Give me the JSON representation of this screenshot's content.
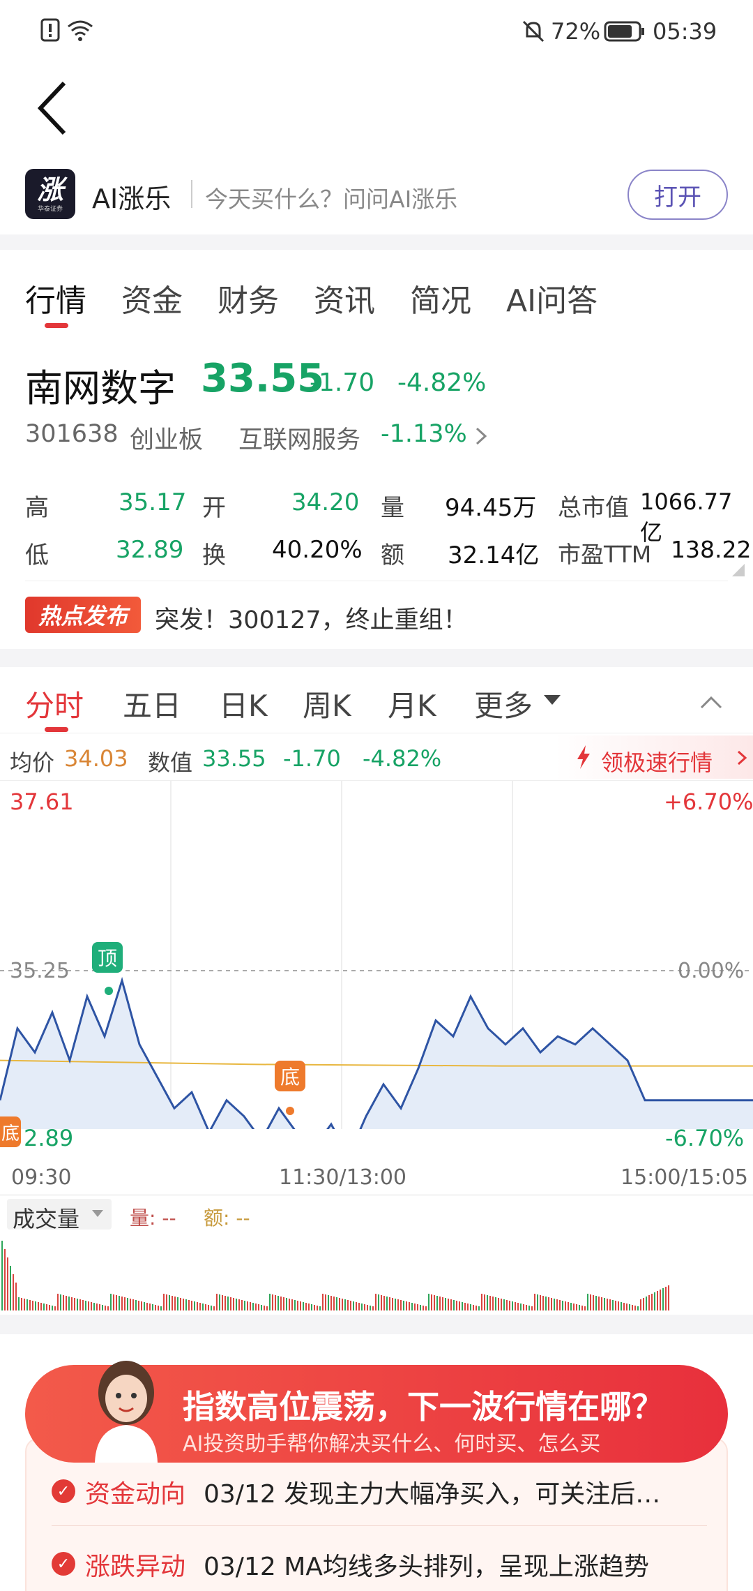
{
  "status_bar": {
    "battery": "72%",
    "time": "05:39"
  },
  "promo": {
    "app_name": "AI涨乐",
    "slogan": "今天买什么？问问AI涨乐",
    "open_label": "打开",
    "logo_char": "涨",
    "logo_sub": "华泰证券"
  },
  "tabs": [
    "行情",
    "资金",
    "财务",
    "资讯",
    "简况",
    "AI问答"
  ],
  "stock": {
    "name": "南网数字",
    "price": "33.55",
    "change": "-1.70",
    "change_pct": "-4.82%",
    "code": "301638",
    "board": "创业板",
    "sector": "互联网服务",
    "sector_pct": "-1.13%"
  },
  "stats": {
    "high_label": "高",
    "high": "35.17",
    "open_label": "开",
    "open": "34.20",
    "vol_label": "量",
    "vol": "94.45万",
    "mcap_label": "总市值",
    "mcap": "1066.77亿",
    "low_label": "低",
    "low": "32.89",
    "turn_label": "换",
    "turn": "40.20%",
    "amt_label": "额",
    "amt": "32.14亿",
    "pe_label": "市盈TTM",
    "pe": "138.22"
  },
  "hot": {
    "badge": "热点发布",
    "text": "突发！300127，终止重组！"
  },
  "chart_tabs": [
    "分时",
    "五日",
    "日K",
    "周K",
    "月K",
    "更多"
  ],
  "info_line": {
    "avg_label": "均价",
    "avg": "34.03",
    "val_label": "数值",
    "val": "33.55",
    "chg": "-1.70",
    "pct": "-4.82%",
    "promo": "领极速行情"
  },
  "chart_labels": {
    "y_top": "37.61",
    "y_mid": "35.25",
    "y_bot": "2.89",
    "pct_top": "+6.70%",
    "pct_mid": "0.00%",
    "pct_bot": "-6.70%",
    "x_start": "09:30",
    "x_mid": "11:30/13:00",
    "x_end": "15:00/15:05",
    "peak_badge": "顶",
    "trough_badge": "底",
    "trough_badge2": "底"
  },
  "volume": {
    "label": "成交量",
    "qty_label": "量: --",
    "amt_label": "额: --"
  },
  "colors": {
    "accent": "#e3363a",
    "down": "#17a365",
    "price_line": "#2e54a4",
    "avg_line": "#e8b740"
  },
  "chart_data": {
    "type": "line",
    "x": [
      "09:30",
      "11:30/13:00",
      "15:00/15:05"
    ],
    "ylim": [
      32.89,
      37.61
    ],
    "series": [
      {
        "name": "",
        "values": [
          33.6,
          34.5,
          34.2,
          34.7,
          34.1,
          34.9,
          34.4,
          35.1,
          34.3,
          33.9,
          33.5,
          33.7,
          33.2,
          33.6,
          33.4,
          33.1,
          33.5,
          33.2,
          33.0,
          33.3,
          32.9,
          33.4,
          33.8,
          33.5,
          34.0,
          34.6,
          34.4,
          34.9,
          34.5,
          34.3,
          34.5,
          34.2,
          34.4,
          34.3,
          34.5,
          34.3,
          34.1,
          33.6,
          33.6
        ]
      },
      {
        "name": "均价",
        "values": [
          34.1,
          34.05,
          34.03,
          34.03
        ]
      }
    ]
  }
}
